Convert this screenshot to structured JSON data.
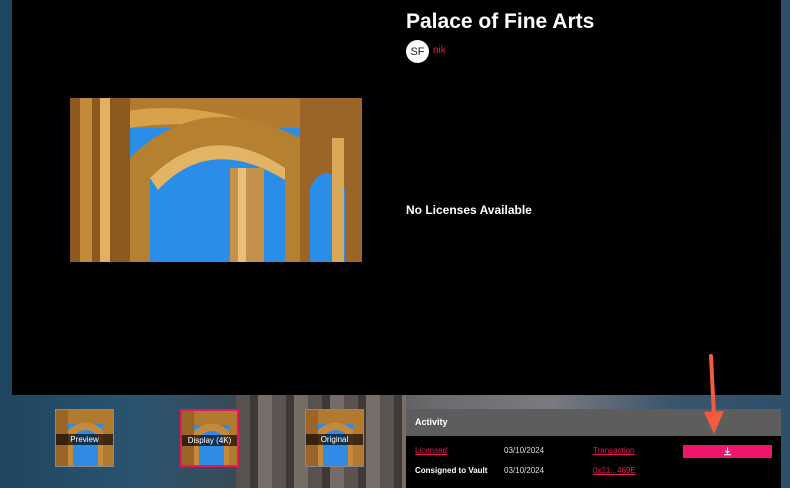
{
  "artwork": {
    "title": "Palace of Fine Arts",
    "avatar_initials": "SF",
    "author": "nik"
  },
  "licenses": {
    "message": "No Licenses Available"
  },
  "thumbnails": [
    {
      "label": "Preview",
      "selected": false
    },
    {
      "label": "Display (4K)",
      "selected": true
    },
    {
      "label": "Original",
      "selected": false
    }
  ],
  "activity": {
    "heading": "Activity",
    "rows": [
      {
        "event": "Licensed",
        "date": "03/10/2024",
        "link": "Transaction"
      },
      {
        "event": "Consigned to Vault",
        "date": "03/10/2024",
        "link": "0x21...469E"
      }
    ],
    "download_icon": "download-icon"
  },
  "colors": {
    "accent": "#e5175f",
    "button": "#f0146a",
    "arrow": "#f25b42"
  }
}
